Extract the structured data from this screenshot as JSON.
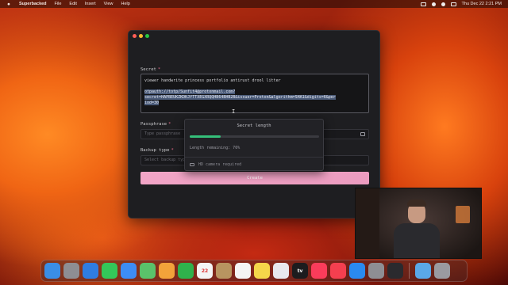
{
  "menubar": {
    "app_name": "Superbacked",
    "menus": [
      "File",
      "Edit",
      "Insert",
      "View",
      "Help"
    ],
    "datetime": "Thu Dec 22  2:21 PM"
  },
  "window": {
    "secret_label": "Secret",
    "secret_lines": [
      "viewer handwrite princess portfolio antirust drool litter",
      "",
      "otpauth://totp/Sunfit4@protonmail.com?",
      "secret=HAPBEUKZKDKJYTTXEGXRQQHB64BHB2B&issuer=Proton&algorithm=SHA1&digits=6&per",
      "iod=30"
    ],
    "passphrase_label": "Passphrase",
    "passphrase_placeholder": "Type passphrase",
    "backup_type_label": "Backup type",
    "backup_type_placeholder": "Select backup type",
    "create_label": "Create",
    "required_marker": "*"
  },
  "popover": {
    "title": "Secret length",
    "progress": 0.24,
    "remaining_text": "Length remaining: 76%",
    "camera_text": "HD camera required"
  },
  "dock": {
    "apps": [
      {
        "name": "Finder",
        "label": "",
        "color": "#3a8ee6"
      },
      {
        "name": "Launchpad",
        "label": "",
        "color": "#8e8e93"
      },
      {
        "name": "Safari",
        "label": "",
        "color": "#2f7de1"
      },
      {
        "name": "Messages",
        "label": "",
        "color": "#34c759"
      },
      {
        "name": "Mail",
        "label": "",
        "color": "#3d8df5"
      },
      {
        "name": "Maps",
        "label": "",
        "color": "#5ac26a"
      },
      {
        "name": "Photos",
        "label": "",
        "color": "#f2a23a"
      },
      {
        "name": "FaceTime",
        "label": "",
        "color": "#2fb24c"
      },
      {
        "name": "Calendar",
        "label": "22",
        "color": "#f4f4f4"
      },
      {
        "name": "Contacts",
        "label": "",
        "color": "#b89460"
      },
      {
        "name": "Reminders",
        "label": "",
        "color": "#f4f4f4"
      },
      {
        "name": "Notes",
        "label": "",
        "color": "#f5d64a"
      },
      {
        "name": "Freeform",
        "label": "",
        "color": "#e8e8ee"
      },
      {
        "name": "TV",
        "label": "tv",
        "color": "#1c1c1e"
      },
      {
        "name": "Music",
        "label": "",
        "color": "#fa3c5a"
      },
      {
        "name": "News",
        "label": "",
        "color": "#f43f4f"
      },
      {
        "name": "App Store",
        "label": "",
        "color": "#2a8af0"
      },
      {
        "name": "System Settings",
        "label": "",
        "color": "#8e8e93"
      },
      {
        "name": "Superbacked",
        "label": "",
        "color": "#2a2a2e"
      },
      {
        "name": "Downloads",
        "label": "",
        "color": "#5aa8e8"
      },
      {
        "name": "Trash",
        "label": "",
        "color": "#9a9aa0"
      }
    ]
  }
}
